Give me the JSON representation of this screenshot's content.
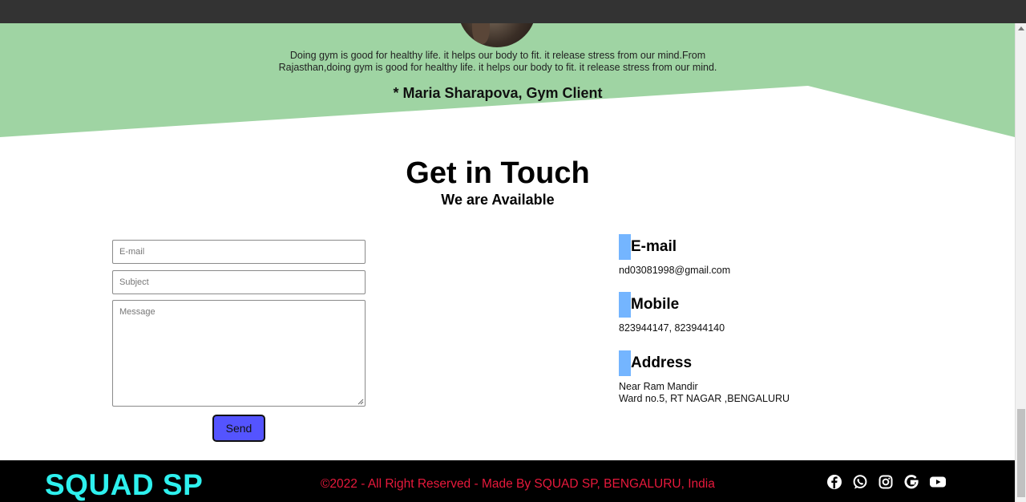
{
  "testimonial": {
    "quote": "Doing gym is good for healthy life. it helps our body to fit. it release stress from our mind.From Rajasthan,doing gym is good for healthy life. it helps our body to fit. it release stress from our mind.",
    "author": "* Maria Sharapova, Gym Client",
    "bg_color": "#9fd4a3"
  },
  "contact": {
    "title": "Get in Touch",
    "subtitle": "We are Available",
    "form": {
      "email_placeholder": "E-mail",
      "subject_placeholder": "Subject",
      "message_placeholder": "Message",
      "send_label": "Send"
    },
    "info": [
      {
        "heading": "E-mail",
        "lines": [
          "nd03081998@gmail.com"
        ]
      },
      {
        "heading": "Mobile",
        "lines": [
          "823944147, 823944140"
        ]
      },
      {
        "heading": "Address",
        "lines": [
          "Near Ram Mandir",
          "Ward no.5, RT NAGAR ,BENGALURU"
        ]
      }
    ],
    "accent_color": "#74b5ff",
    "button_color": "#5454ff"
  },
  "footer": {
    "brand": "SQUAD SP",
    "copyright": "©2022 - All Right Reserved - Made By SQUAD SP, BENGALURU, India",
    "brand_color": "#2ef0ee",
    "copyright_color": "#e8193c",
    "socials": [
      "facebook-icon",
      "whatsapp-icon",
      "instagram-icon",
      "google-icon",
      "youtube-icon"
    ]
  }
}
